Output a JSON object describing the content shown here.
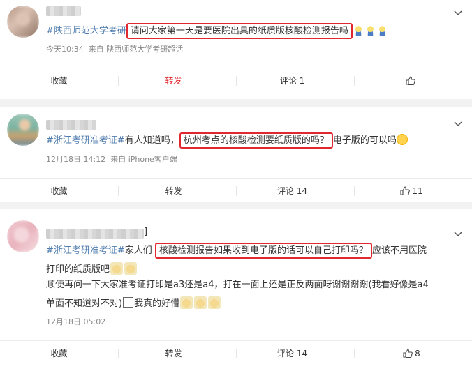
{
  "posts": [
    {
      "tag": "#陕西师范大学考研",
      "pre": "",
      "highlight": "请问大家第一天是要医院出具的纸质版核酸检测报告吗",
      "post_text": "",
      "time": "今天10:34",
      "source": "来自 陕西师范大学考研超话",
      "actions": {
        "collect": "收藏",
        "repost": "转发",
        "comment": "评论 1",
        "like": ""
      }
    },
    {
      "tag": "#浙江考研准考证#",
      "pre": "有人知道吗，",
      "highlight": "杭州考点的核酸检测要纸质版的吗？",
      "post_text": "电子版的可以吗",
      "time": "12月18日 14:12",
      "source": "来自 iPhone客户端",
      "actions": {
        "collect": "收藏",
        "repost": "转发",
        "comment": "评论 14",
        "like": "11"
      }
    },
    {
      "name_tail": "]_",
      "tag": "#浙江考研准考证#",
      "pre": "家人们 ",
      "highlight": "核酸检测报告如果收到电子版的话可以自己打印吗？",
      "post_text": "应该不用医院",
      "line2": "打印的纸质版吧",
      "line3": "顺便再问一下大家准考证打印是a3还是a4，打在一面上还是正反两面呀谢谢谢谢(我看好像是a4",
      "line4a": "单面不知道对不对)",
      "line4b": "我真的好懵",
      "time": "12月18日 05:02",
      "actions": {
        "collect": "收藏",
        "repost": "转发",
        "comment": "评论 14",
        "like": "8"
      }
    }
  ]
}
